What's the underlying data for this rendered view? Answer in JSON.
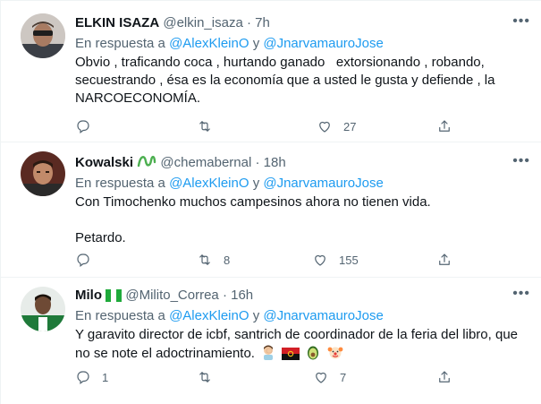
{
  "tweets": [
    {
      "name": "ELKIN ISAZA",
      "handle": "@elkin_isaza",
      "separator": "·",
      "time": "7h",
      "reply_prefix": "En respuesta a",
      "mention1": "@AlexKleinO",
      "conjunction": "y",
      "mention2": "@JnarvamauroJose",
      "text_lines": [
        "Obvio , traficando coca , hurtando ganado   extorsionando , robando,",
        "secuestrando , ésa es la economía que a usted le gusta y defiende , la",
        "NARCOECONOMÍA."
      ],
      "reply_count": "",
      "retweet_count": "",
      "like_count": "27"
    },
    {
      "name": "Kowalski",
      "name_badge_icon": "green-loop-emoji",
      "handle": "@chemabernal",
      "separator": "·",
      "time": "18h",
      "reply_prefix": "En respuesta a",
      "mention1": "@AlexKleinO",
      "conjunction": "y",
      "mention2": "@JnarvamauroJose",
      "text_lines": [
        "Con Timochenko muchos campesinos ahora no tienen vida.",
        "",
        "Petardo."
      ],
      "reply_count": "",
      "retweet_count": "8",
      "like_count": "155"
    },
    {
      "name": "Milo",
      "name_badge_icon": "nigeria-flag-emoji",
      "handle": "@Milito_Correa",
      "separator": "·",
      "time": "16h",
      "reply_prefix": "En respuesta a",
      "mention1": "@AlexKleinO",
      "conjunction": "y",
      "mention2": "@JnarvamauroJose",
      "text_lines": [
        "Y garavito director de icbf, santrich de coordinador de la feria del libro, que",
        "no se note el adoctrinamiento."
      ],
      "trailing_emojis": [
        "man-facepalming-emoji",
        "angola-flag-emoji",
        "avocado-emoji",
        "clown-face-emoji"
      ],
      "reply_count": "1",
      "retweet_count": "",
      "like_count": "7"
    }
  ],
  "colors": {
    "accent": "#1d9bf0",
    "muted": "#536471",
    "text": "#0f1419",
    "divider": "#eff3f4"
  }
}
